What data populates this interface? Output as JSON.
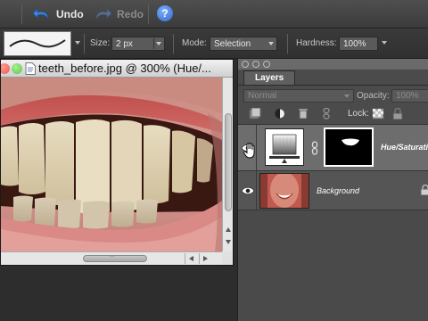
{
  "toolbar": {
    "undo_label": "Undo",
    "redo_label": "Redo",
    "help_label": "?",
    "undo_icon": "undo-arrow-icon",
    "redo_icon": "redo-arrow-icon",
    "help_icon": "help-icon"
  },
  "options": {
    "size_label": "Size:",
    "size_value": "2 px",
    "mode_label": "Mode:",
    "mode_value": "Selection",
    "hardness_label": "Hardness:",
    "hardness_value": "100%"
  },
  "document": {
    "title": "teeth_before.jpg @ 300% (Hue/...",
    "scroll_grip": "..."
  },
  "layers_panel": {
    "tab_label": "Layers",
    "blend_mode": "Normal",
    "opacity_label": "Opacity:",
    "opacity_value": "100%",
    "lock_label": "Lock:",
    "layers": [
      {
        "name": "Hue/Saturation",
        "selected": true
      },
      {
        "name": "Background",
        "selected": false
      }
    ]
  },
  "colors": {
    "window_close": "#ec5a50",
    "window_minimize": "#e8b43a",
    "window_zoom": "#5cc34a",
    "help_blue": "#2f66c8",
    "selected_layer": "#6d6d6d"
  }
}
